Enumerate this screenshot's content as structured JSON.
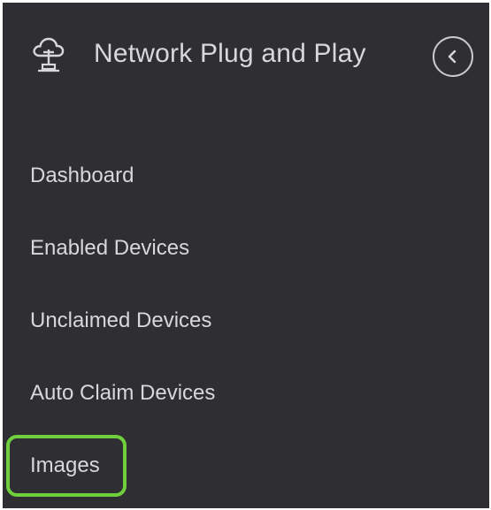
{
  "header": {
    "title": "Network Plug and Play",
    "icon": "cloud-network-icon",
    "collapse_icon": "chevron-left-icon"
  },
  "nav": {
    "items": [
      {
        "label": "Dashboard"
      },
      {
        "label": "Enabled Devices"
      },
      {
        "label": "Unclaimed Devices"
      },
      {
        "label": "Auto Claim Devices"
      },
      {
        "label": "Images",
        "highlighted": true
      }
    ]
  },
  "colors": {
    "panel_background": "#2e2e33",
    "text": "#d7d7dc",
    "highlight_border": "#6fcf3c"
  }
}
